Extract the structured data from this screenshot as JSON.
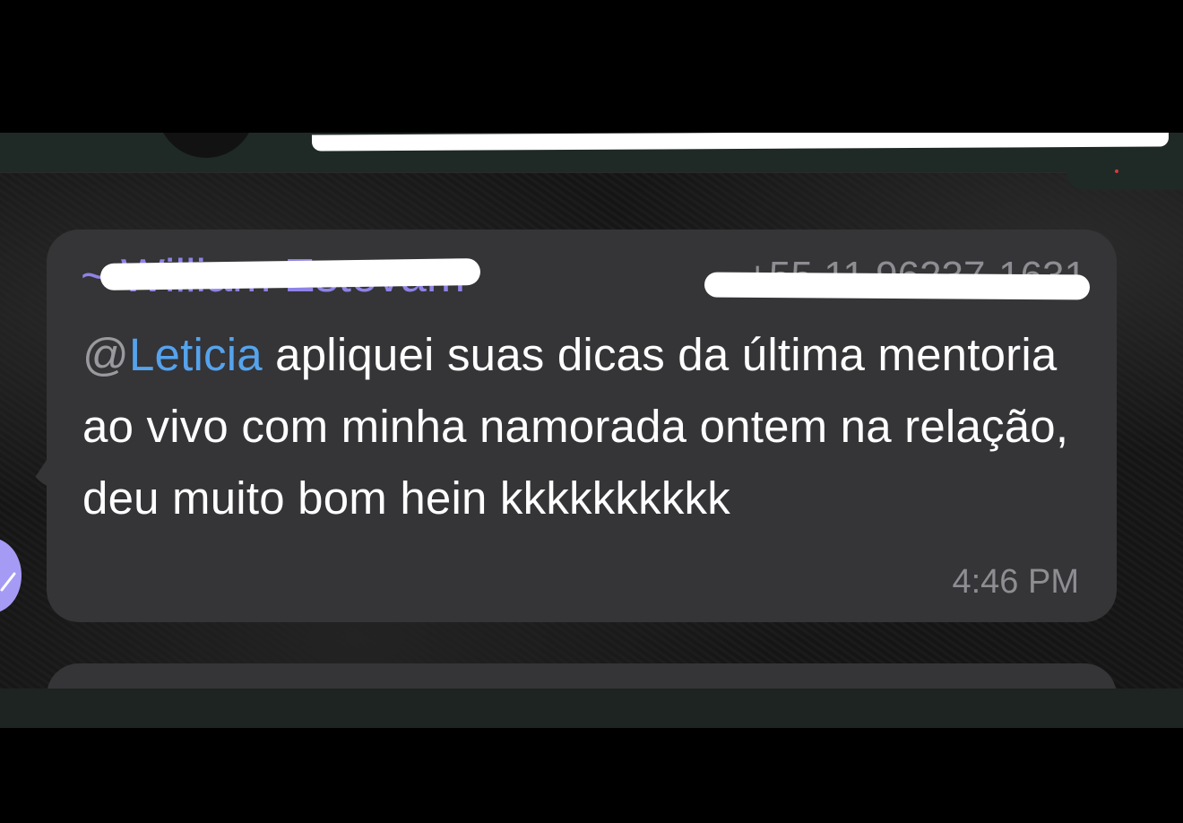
{
  "message": {
    "sender_name": "~ William Estevam",
    "sender_phone": "+55 11 96237-1631",
    "mention_at": "@",
    "mention_name": "Leticia",
    "body": " apliquei suas dicas da última mentoria ao vivo com minha namorada ontem na relação, deu muito bom hein kkkkkkkkkk",
    "timestamp": "4:46 PM"
  },
  "colors": {
    "bubble": "#353437",
    "sender_name": "#8e83e6",
    "mention": "#55a3ec",
    "meta_gray": "#8d8d92",
    "text": "#ffffff",
    "avatar": "#a59bf5"
  },
  "icons": {
    "avatar": "user-avatar-icon"
  }
}
